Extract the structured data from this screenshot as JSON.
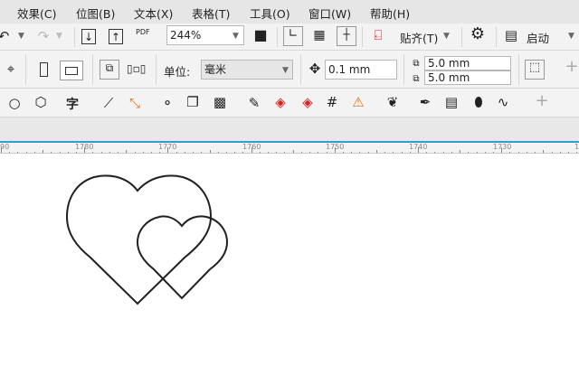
{
  "menu": [
    "效果(C)",
    "位图(B)",
    "文本(X)",
    "表格(T)",
    "工具(O)",
    "窗口(W)",
    "帮助(H)"
  ],
  "toolbar": {
    "zoom": "244%",
    "snap": "贴齐(T)",
    "launch": "启动",
    "pdf": "PDF"
  },
  "propbar": {
    "unit_label": "单位:",
    "unit_value": "毫米",
    "nudge": "0.1 mm",
    "dup_x": "5.0 mm",
    "dup_y": "5.0 mm"
  },
  "toolbox": {
    "text_tool": "字"
  },
  "ruler": {
    "labels": [
      "90",
      "1780",
      "1770",
      "1760",
      "1750",
      "1740",
      "1730",
      "1"
    ]
  },
  "colors": {
    "accent": "#2a9fd8",
    "stroke": "#231f20"
  }
}
